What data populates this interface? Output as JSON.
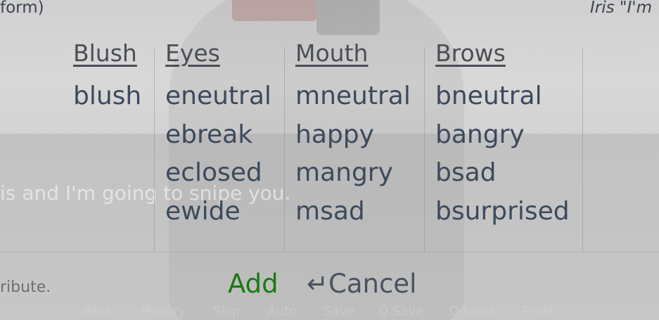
{
  "background": {
    "speaker_left": "form)",
    "speaker_right": "Iris \"I'm",
    "dialogue": "is and I'm going to snipe you.",
    "hint": "ribute."
  },
  "picker": {
    "columns": [
      {
        "heading": "Blush",
        "options": [
          "blush"
        ]
      },
      {
        "heading": "Eyes",
        "options": [
          "eneutral",
          "ebreak",
          "eclosed",
          "ewide"
        ]
      },
      {
        "heading": "Mouth",
        "options": [
          "mneutral",
          "happy",
          "mangry",
          "msad"
        ]
      },
      {
        "heading": "Brows",
        "options": [
          "bneutral",
          "bangry",
          "bsad",
          "bsurprised"
        ]
      }
    ],
    "add_label": "Add",
    "cancel_label": "↵Cancel"
  },
  "quick_menu": [
    "Back",
    "History",
    "Skip",
    "Auto",
    "Save",
    "Q.Save",
    "Q.Load",
    "Prefs"
  ],
  "colors": {
    "add": "#1a7a10",
    "text": "#3c4a5c"
  }
}
